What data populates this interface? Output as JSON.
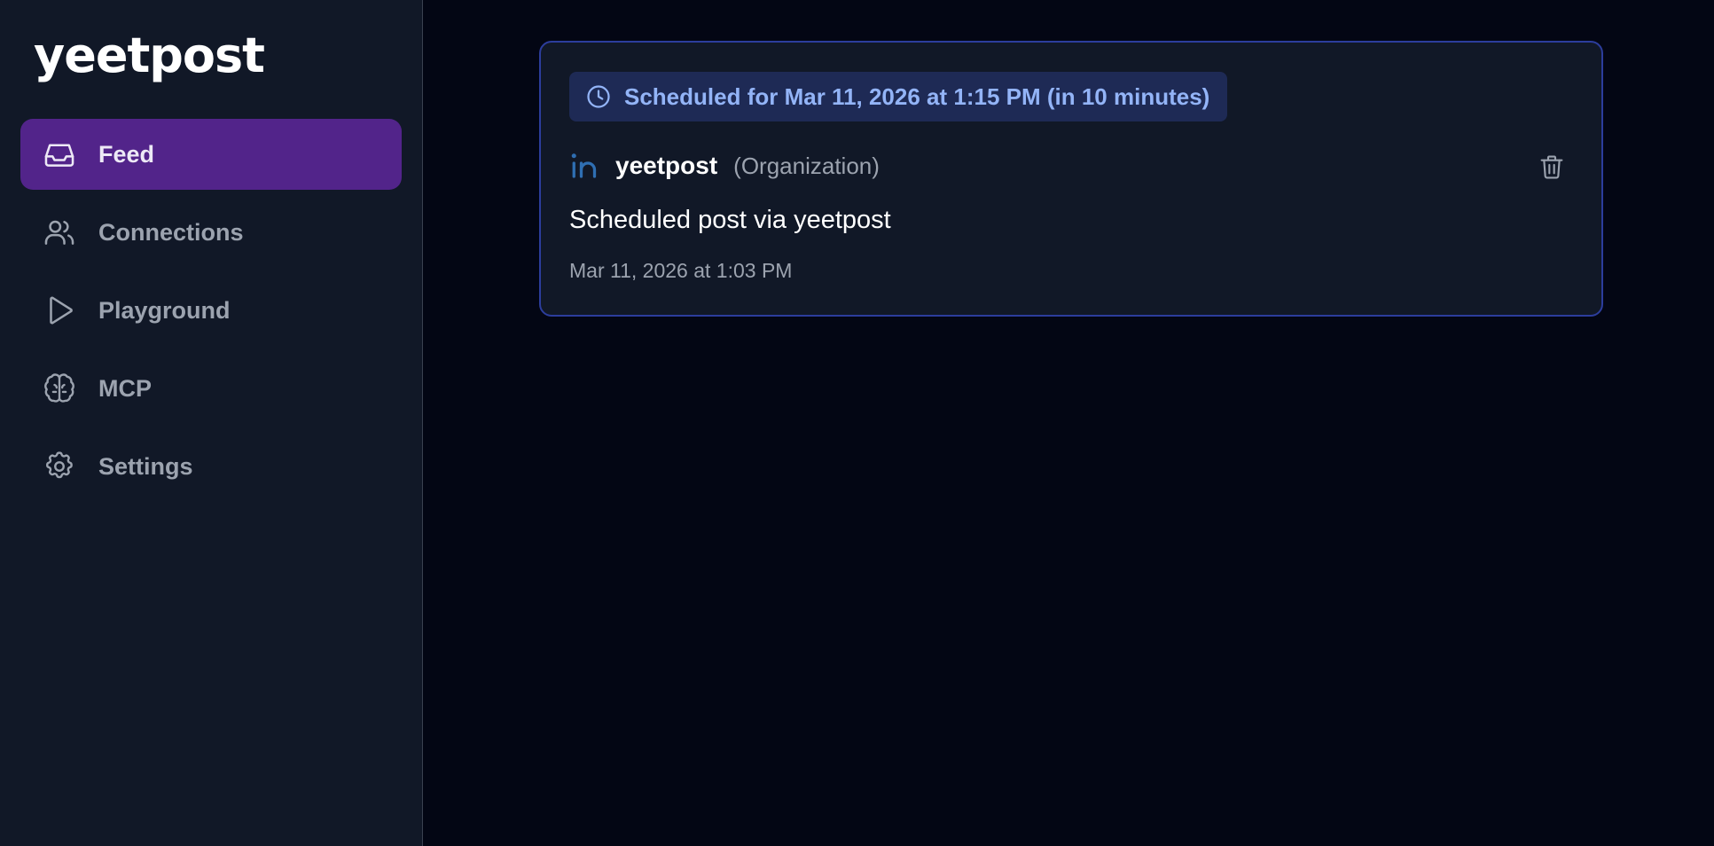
{
  "app": {
    "logo_text": "yeetpost"
  },
  "sidebar": {
    "items": [
      {
        "label": "Feed",
        "icon": "inbox-icon",
        "active": true
      },
      {
        "label": "Connections",
        "icon": "users-icon",
        "active": false
      },
      {
        "label": "Playground",
        "icon": "play-icon",
        "active": false
      },
      {
        "label": "MCP",
        "icon": "brain-icon",
        "active": false
      },
      {
        "label": "Settings",
        "icon": "gear-icon",
        "active": false
      }
    ]
  },
  "post": {
    "schedule_label": "Scheduled for Mar 11, 2026 at 1:15 PM (in 10 minutes)",
    "platform_icon": "linkedin-icon",
    "account_name": "yeetpost",
    "account_type": "(Organization)",
    "content": "Scheduled post via yeetpost",
    "created_at": "Mar 11, 2026 at 1:03 PM",
    "delete_icon": "trash-icon"
  },
  "colors": {
    "active_nav_bg": "#52248a",
    "card_border": "#2c3d9c",
    "badge_bg": "#1e2a55",
    "badge_text": "#93b4f7",
    "linkedin_blue": "#2f6fb3"
  }
}
